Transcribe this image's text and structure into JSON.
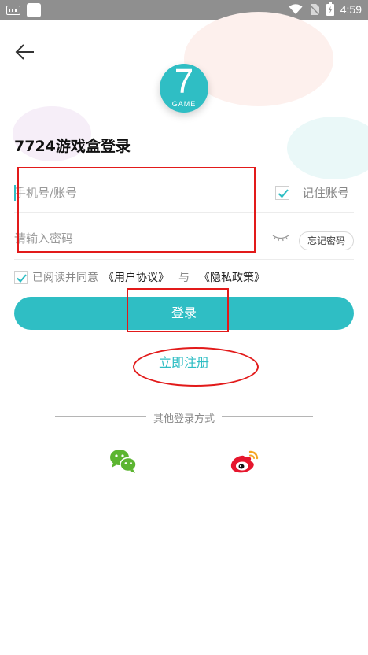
{
  "status_bar": {
    "time": "4:59"
  },
  "logo": {
    "number": "7",
    "word": "GAME"
  },
  "title": "7724游戏盒登录",
  "account": {
    "placeholder": "手机号/账号",
    "value": ""
  },
  "remember": {
    "label": "记住账号",
    "checked": true
  },
  "password": {
    "placeholder": "请输入密码",
    "value": ""
  },
  "forgot": {
    "label": "忘记密码"
  },
  "agreement": {
    "checked": true,
    "text": "已阅读并同意",
    "user_agreement": "《用户协议》",
    "and": "与",
    "privacy_policy": "《隐私政策》"
  },
  "login_button": {
    "label": "登录"
  },
  "register_link": {
    "label": "立即注册"
  },
  "other_login": {
    "label": "其他登录方式",
    "providers": [
      "wechat",
      "weibo"
    ]
  },
  "colors": {
    "accent": "#2fbec4",
    "statusbar": "#8f8f8f",
    "annotation": "#e21a1a"
  }
}
